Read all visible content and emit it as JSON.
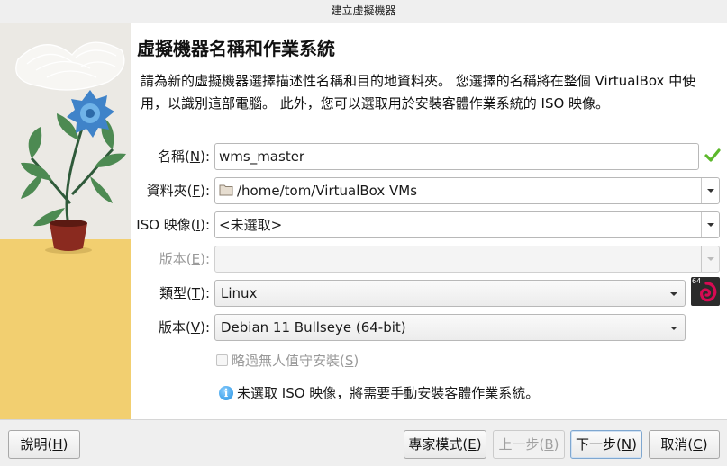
{
  "window": {
    "title": "建立虛擬機器"
  },
  "page": {
    "heading": "虛擬機器名稱和作業系統",
    "description": "請為新的虛擬機器選擇描述性名稱和目的地資料夾。 您選擇的名稱將在整個 VirtualBox 中使用，以識別這部電腦。 此外，您可以選取用於安裝客體作業系統的 ISO 映像。"
  },
  "form": {
    "name": {
      "label": "名稱(",
      "mnemonic": "N",
      "label_end": "):",
      "value": "wms_master"
    },
    "folder": {
      "label": "資料夾(",
      "mnemonic": "F",
      "label_end": "):",
      "value": "/home/tom/VirtualBox VMs"
    },
    "iso": {
      "label": "ISO 映像(",
      "mnemonic": "I",
      "label_end": "):",
      "value": "<未選取>"
    },
    "edition": {
      "label": "版本(",
      "mnemonic": "E",
      "label_end": "):",
      "value": ""
    },
    "type": {
      "label": "類型(",
      "mnemonic": "T",
      "label_end": "):",
      "value": "Linux"
    },
    "version": {
      "label": "版本(",
      "mnemonic": "V",
      "label_end": "):",
      "value": "Debian 11 Bullseye (64-bit)"
    },
    "unattended": {
      "label": "略過無人值守安裝(",
      "mnemonic": "S",
      "label_end": ")",
      "checked": false
    },
    "os_icon_badge": "64",
    "info_text": "未選取 ISO 映像，將需要手動安裝客體作業系統。"
  },
  "buttons": {
    "help": {
      "label": "說明(",
      "mnemonic": "H",
      "label_end": ")"
    },
    "expert": {
      "label": "專家模式(",
      "mnemonic": "E",
      "label_end": ")"
    },
    "back": {
      "label": "上一步(",
      "mnemonic": "B",
      "label_end": ")"
    },
    "next": {
      "label": "下一步(",
      "mnemonic": "N",
      "label_end": ")"
    },
    "cancel": {
      "label": "取消(",
      "mnemonic": "C",
      "label_end": ")"
    }
  },
  "icons": {
    "valid": "check-icon",
    "folder": "folder-icon",
    "info": "info-icon",
    "os": "debian-swirl-icon"
  },
  "colors": {
    "valid_check": "#5cb82b",
    "info_blue": "#1f8ee0",
    "debian_red": "#d70a53",
    "illustration_sand": "#f2cf70"
  }
}
